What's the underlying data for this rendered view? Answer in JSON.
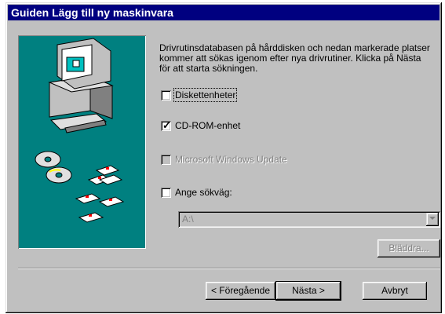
{
  "window": {
    "title": "Guiden Lägg till ny maskinvara"
  },
  "description": "Drivrutinsdatabasen på hårddisken och nedan markerade platser kommer att sökas igenom efter nya drivrutiner. Klicka på Nästa för att starta sökningen.",
  "options": {
    "floppy": {
      "label": "Diskettenheter",
      "checked": false
    },
    "cdrom": {
      "label": "CD-ROM-enhet",
      "checked": true
    },
    "windows_update": {
      "label": "Microsoft Windows Update",
      "checked": false,
      "enabled": false
    },
    "path": {
      "label": "Ange sökväg:",
      "checked": false
    }
  },
  "path_combo": {
    "value": "A:\\",
    "enabled": false
  },
  "buttons": {
    "browse": "Bläddra...",
    "back": "< Föregående",
    "next": "Nästa >",
    "cancel": "Avbryt"
  },
  "colors": {
    "titlebar": "#000080",
    "illustration_bg": "#008080",
    "face": "#c0c0c0"
  }
}
